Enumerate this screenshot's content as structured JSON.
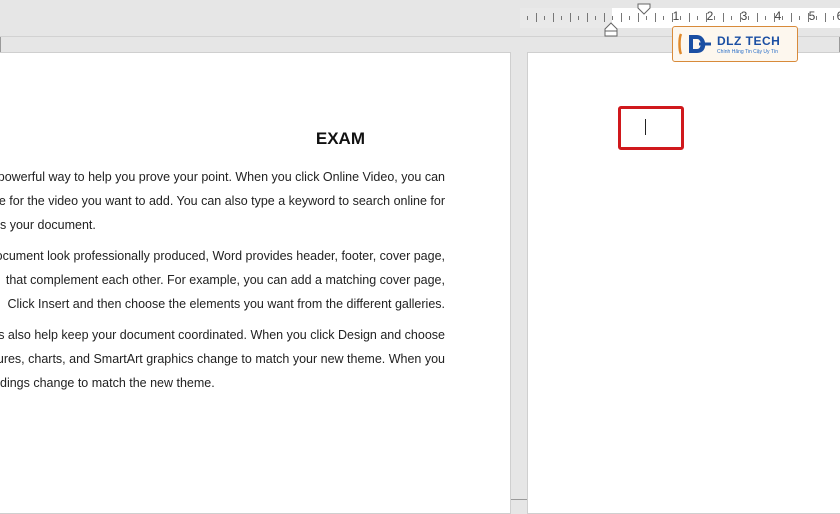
{
  "ruler": {
    "labels": [
      "1",
      "2",
      "3",
      "4",
      "5",
      "6"
    ]
  },
  "document": {
    "title": "EXAM",
    "lines": [
      "a powerful way to help you prove your point. When you click Online Video, you can",
      "ode for the video you want to add. You can also type a keyword to search online for",
      "s your document.",
      "document look professionally produced, Word provides header, footer, cover page,",
      "that complement each other. For example, you can add a matching cover page,",
      "Click Insert and then choose the elements you want from the different galleries.",
      "yles also help keep your document coordinated. When you click Design and choose",
      "ctures, charts, and SmartArt graphics change to match your new theme. When you",
      "dings change to match the new theme."
    ]
  },
  "logo": {
    "name": "DLZ TECH",
    "tagline": "Chính Hãng Tin Cậy Uy Tín"
  },
  "colors": {
    "highlight": "#d0181c",
    "logo_blue": "#1b4fa3",
    "logo_border": "#d88a3a"
  }
}
